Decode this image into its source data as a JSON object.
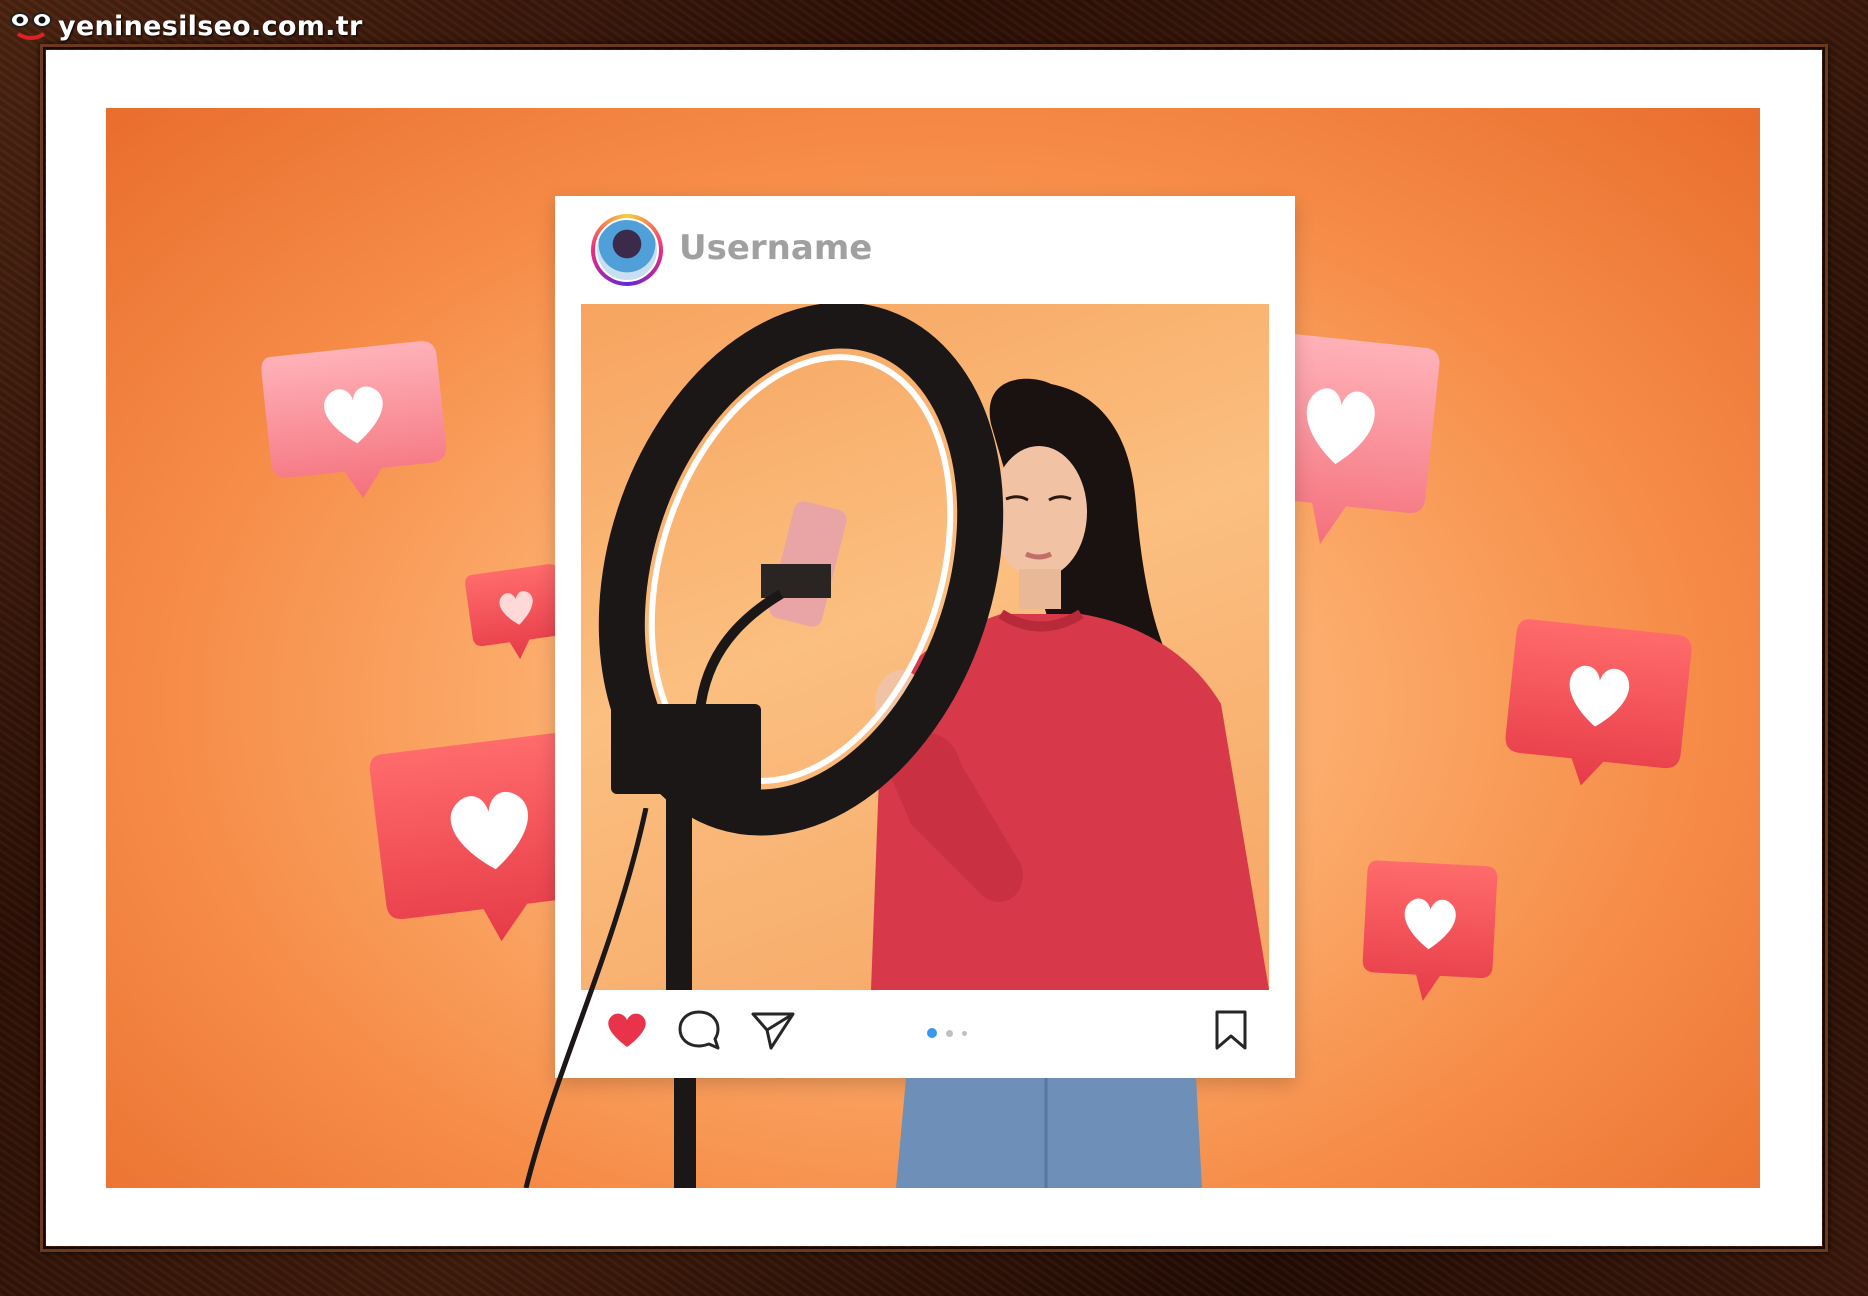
{
  "watermark": {
    "site": "yeninesilseo.com.tr"
  },
  "post": {
    "username": "Username",
    "carousel": {
      "total_dots": 3,
      "active_index": 0
    },
    "liked": true,
    "accent_like_color": "#e8334a",
    "active_dot_color": "#3897f0"
  },
  "icons": {
    "like": "heart-icon",
    "comment": "comment-icon",
    "share": "paper-plane-icon",
    "save": "bookmark-icon",
    "notification": "heart-bubble-icon"
  },
  "colors": {
    "background_orange": "#f68c48",
    "sweater_red": "#d8394a",
    "frame_wood": "#3a170a"
  }
}
